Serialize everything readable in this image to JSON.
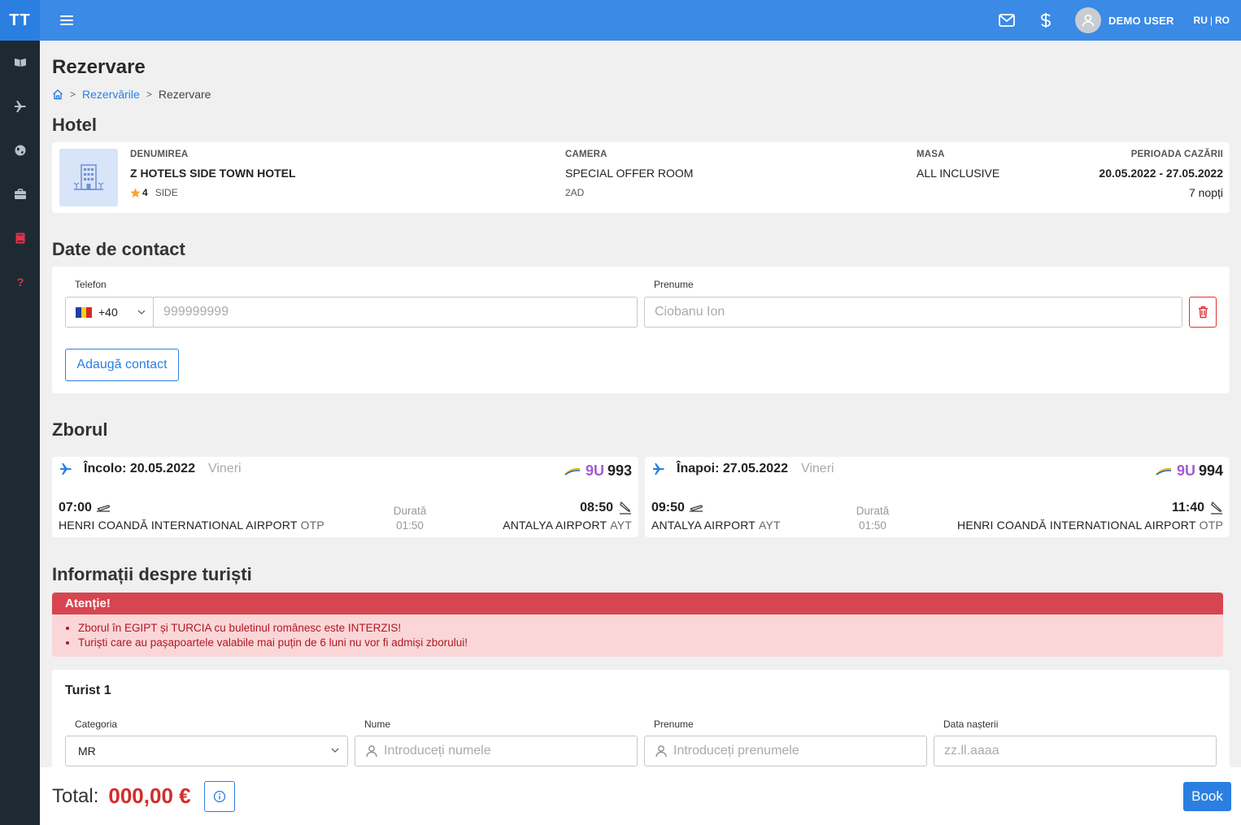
{
  "app": {
    "logo": "TT"
  },
  "sidebar": {
    "items": [
      {
        "icon": "book-open-icon",
        "color": "#b8c0c8"
      },
      {
        "icon": "plane-icon",
        "color": "#b8c0c8"
      },
      {
        "icon": "globe-icon",
        "color": "#b8c0c8"
      },
      {
        "icon": "briefcase-icon",
        "color": "#b8c0c8"
      },
      {
        "icon": "book-icon",
        "color": "#e0344b"
      },
      {
        "icon": "help-icon",
        "color": "#e0344b"
      }
    ]
  },
  "topbar": {
    "user_name": "DEMO USER",
    "lang_ru": "RU",
    "lang_sep": "|",
    "lang_ro": "RO"
  },
  "page": {
    "title": "Rezervare",
    "breadcrumb": {
      "link": "Rezervările",
      "current": "Rezervare"
    }
  },
  "hotel": {
    "section_title": "Hotel",
    "name_label": "DENUMIREA",
    "name": "Z HOTELS SIDE TOWN HOTEL",
    "stars": "4",
    "location": "SIDE",
    "room_label": "CAMERA",
    "room": "SPECIAL OFFER ROOM",
    "room_pax": "2AD",
    "meal_label": "MASA",
    "meal": "ALL INCLUSIVE",
    "period_label": "PERIOADA CAZĂRII",
    "period": "20.05.2022 - 27.05.2022",
    "nights": "7 nopți"
  },
  "contact": {
    "section_title": "Date de contact",
    "phone_label": "Telefon",
    "phone_code": "+40",
    "phone_placeholder": "999999999",
    "firstname_label": "Prenume",
    "firstname_placeholder": "Ciobanu Ion",
    "add_button": "Adaugă contact"
  },
  "flights": {
    "section_title": "Zborul",
    "outbound": {
      "label": "Încolo: 20.05.2022",
      "day": "Vineri",
      "carrier_code": "9U",
      "number": "993",
      "dep_time": "07:00",
      "dep_airport": "HENRI COANDĂ INTERNATIONAL AIRPORT",
      "dep_iata": "OTP",
      "duration_label": "Durată",
      "duration": "01:50",
      "arr_time": "08:50",
      "arr_airport": "ANTALYA AIRPORT",
      "arr_iata": "AYT"
    },
    "inbound": {
      "label": "Înapoi: 27.05.2022",
      "day": "Vineri",
      "carrier_code": "9U",
      "number": "994",
      "dep_time": "09:50",
      "dep_airport": "ANTALYA AIRPORT",
      "dep_iata": "AYT",
      "duration_label": "Durată",
      "duration": "01:50",
      "arr_time": "11:40",
      "arr_airport": "HENRI COANDĂ INTERNATIONAL AIRPORT",
      "arr_iata": "OTP"
    }
  },
  "tourists": {
    "section_title": "Informații despre turiști",
    "alert_title": "Atenție!",
    "alert_items": [
      "Zborul în EGIPT și TURCIA cu buletinul românesc este INTERZIS!",
      "Turiști care au pașapoartele valabile mai puțin de 6 luni nu vor fi admiși zborului!"
    ],
    "tourist1": {
      "title": "Turist 1",
      "category_label": "Categoria",
      "category_value": "MR",
      "lastname_label": "Nume",
      "lastname_placeholder": "Introduceți numele",
      "firstname_label": "Prenume",
      "firstname_placeholder": "Introduceți prenumele",
      "birth_label": "Data nașterii",
      "birth_placeholder": "zz.ll.aaaa"
    }
  },
  "footer": {
    "total_label": "Total:",
    "total_value": "000,00 €",
    "book_button": "Book"
  },
  "colors": {
    "primary": "#2b7fe0",
    "topbar": "#3a8ae6",
    "sidebar": "#1e2a33",
    "danger": "#d42b2b",
    "carrier": "#a35bd6"
  }
}
